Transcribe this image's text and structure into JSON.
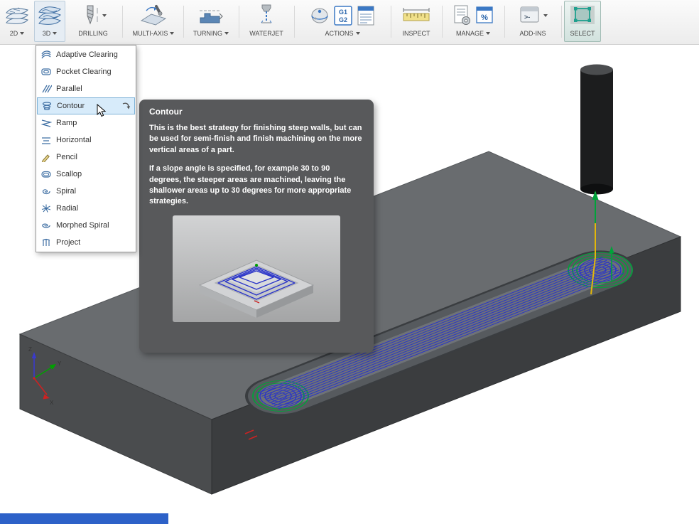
{
  "toolbar": {
    "groups": [
      {
        "label": "2D"
      },
      {
        "label": "3D"
      },
      {
        "label": "DRILLING"
      },
      {
        "label": "MULTI-AXIS"
      },
      {
        "label": "TURNING"
      },
      {
        "label": "WATERJET"
      },
      {
        "label": "ACTIONS"
      },
      {
        "label": "INSPECT"
      },
      {
        "label": "MANAGE"
      },
      {
        "label": "ADD-INS"
      },
      {
        "label": "SELECT"
      }
    ],
    "icon_text": {
      "g1": "G1",
      "g2": "G2",
      "percent": "%",
      "addins": ">-"
    }
  },
  "menu3d": {
    "items": [
      {
        "label": "Adaptive Clearing"
      },
      {
        "label": "Pocket Clearing"
      },
      {
        "label": "Parallel"
      },
      {
        "label": "Contour",
        "selected": true
      },
      {
        "label": "Ramp"
      },
      {
        "label": "Horizontal"
      },
      {
        "label": "Pencil"
      },
      {
        "label": "Scallop"
      },
      {
        "label": "Spiral"
      },
      {
        "label": "Radial"
      },
      {
        "label": "Morphed Spiral"
      },
      {
        "label": "Project"
      }
    ]
  },
  "tooltip": {
    "title": "Contour",
    "body1": "This is the best strategy for finishing steep walls, but can be used for semi-finish and finish machining on the more vertical areas of a part.",
    "body2": "If a slope angle is specified, for example 30 to 90 degrees, the steeper areas are machined, leaving the shallower areas up to 30 degrees for more appropriate strategies."
  },
  "viewport": {
    "axes": {
      "x": "X",
      "y": "Y",
      "z": "Z"
    }
  },
  "colors": {
    "toolpath_blue": "#2b35c8",
    "lead_green": "#00a33a",
    "highlight_row": "#d7ebfa",
    "tooltip_bg": "#58595b",
    "select_teal": "#1fa08e",
    "timeline_blue": "#2d61c8"
  }
}
